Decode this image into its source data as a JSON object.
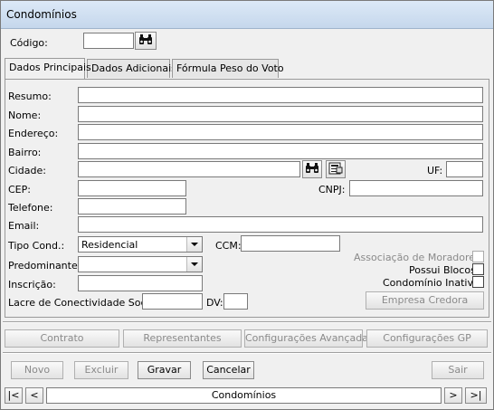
{
  "window": {
    "title": "Condomínios"
  },
  "codigo": {
    "label": "Código:",
    "value": ""
  },
  "tabs": [
    {
      "label": "Dados Principais"
    },
    {
      "label": "Dados Adicionais"
    },
    {
      "label": "Fórmula Peso do Voto"
    }
  ],
  "fields": {
    "resumo": {
      "label": "Resumo:",
      "value": ""
    },
    "nome": {
      "label": "Nome:",
      "value": ""
    },
    "endereco": {
      "label": "Endereço:",
      "value": ""
    },
    "bairro": {
      "label": "Bairro:",
      "value": ""
    },
    "cidade": {
      "label": "Cidade:",
      "value": ""
    },
    "uf": {
      "label": "UF:",
      "value": ""
    },
    "cep": {
      "label": "CEP:",
      "value": ""
    },
    "cnpj": {
      "label": "CNPJ:",
      "value": ""
    },
    "telefone": {
      "label": "Telefone:",
      "value": ""
    },
    "email": {
      "label": "Email:",
      "value": ""
    },
    "tipo_cond": {
      "label": "Tipo Cond.:",
      "value": "Residencial"
    },
    "ccm": {
      "label": "CCM:",
      "value": ""
    },
    "predominante": {
      "label": "Predominante:",
      "value": ""
    },
    "inscricao": {
      "label": "Inscrição:",
      "value": ""
    },
    "lacre": {
      "label": "Lacre de Conectividade Social:",
      "value": ""
    },
    "dv": {
      "label": "DV:",
      "value": ""
    }
  },
  "checkboxes": {
    "associacao": {
      "label": "Associação de Moradores",
      "checked": false,
      "enabled": false
    },
    "possui_blocos": {
      "label": "Possui Blocos",
      "checked": false,
      "enabled": true
    },
    "inativo": {
      "label": "Condomínio Inativo",
      "checked": false,
      "enabled": true
    }
  },
  "buttons": {
    "empresa_credora": "Empresa Credora",
    "contrato": "Contrato",
    "representantes": "Representantes",
    "config_avancadas": "Configurações Avançadas",
    "config_gp": "Configurações GP",
    "novo": "Novo",
    "excluir": "Excluir",
    "gravar": "Gravar",
    "cancelar": "Cancelar",
    "sair": "Sair"
  },
  "navigator": {
    "first": "|<",
    "prev": "<",
    "label": "Condomínios",
    "next": ">",
    "last": ">|"
  },
  "icons": {
    "search": "binoculars-icon",
    "lookup": "form-lookup-icon"
  }
}
